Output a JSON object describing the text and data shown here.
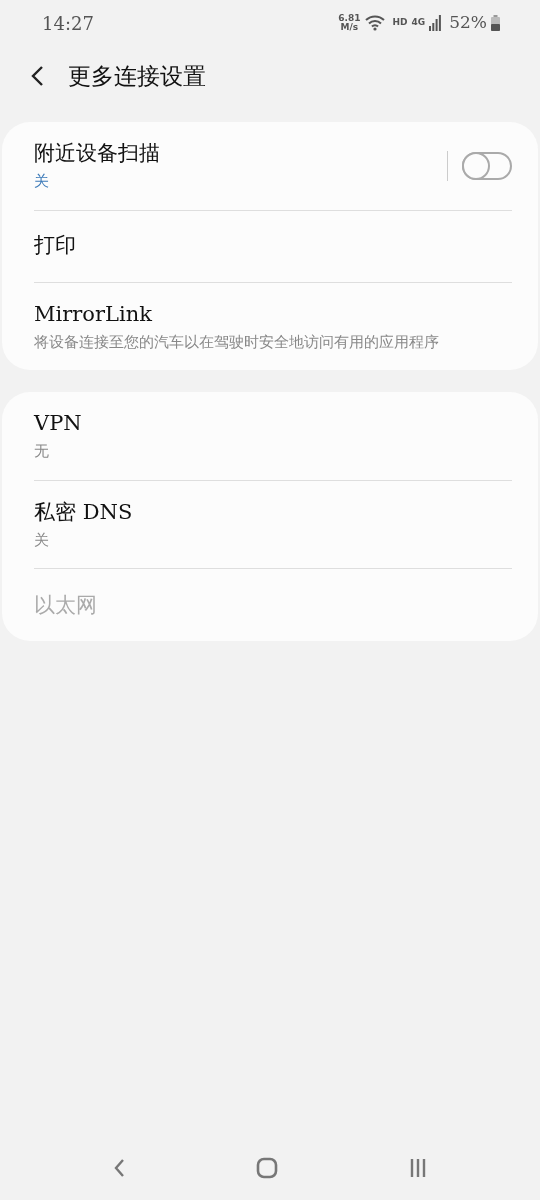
{
  "status_bar": {
    "time": "14:27",
    "speed_value": "6.81",
    "speed_unit": "M/s",
    "hd": "HD",
    "network": "4G",
    "battery": "52%"
  },
  "header": {
    "title": "更多连接设置"
  },
  "groups": [
    {
      "items": [
        {
          "title": "附近设备扫描",
          "summary": "关",
          "summary_accent": true,
          "disabled": false,
          "toggle": {
            "on": false
          }
        },
        {
          "title": "打印",
          "disabled": false
        },
        {
          "title": "MirrorLink",
          "summary": "将设备连接至您的汽车以在驾驶时安全地访问有用的应用程序",
          "summary_accent": false,
          "disabled": false
        }
      ]
    },
    {
      "items": [
        {
          "title": "VPN",
          "summary": "无",
          "summary_accent": false,
          "disabled": false
        },
        {
          "title": "私密 DNS",
          "summary": "关",
          "summary_accent": false,
          "disabled": false
        },
        {
          "title": "以太网",
          "disabled": true
        }
      ]
    }
  ]
}
